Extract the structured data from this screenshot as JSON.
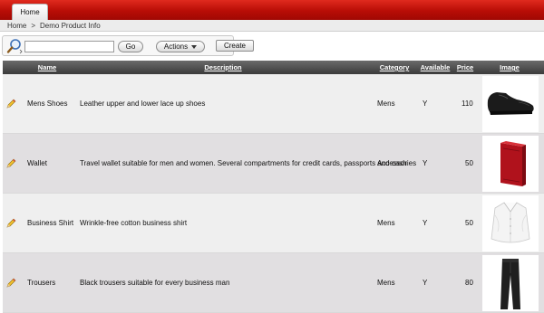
{
  "tabs": [
    {
      "label": "Home"
    }
  ],
  "breadcrumb": {
    "items": [
      "Home",
      "Demo Product Info"
    ],
    "separator": ">"
  },
  "search": {
    "value": "",
    "placeholder": "",
    "go_label": "Go",
    "actions_label": "Actions"
  },
  "toolbar": {
    "create_label": "Create"
  },
  "table": {
    "headers": {
      "name": "Name",
      "description": "Description",
      "category": "Category",
      "available": "Available",
      "price": "Price",
      "image": "Image"
    },
    "rows": [
      {
        "name": "Mens Shoes",
        "description": "Leather upper and lower lace up shoes",
        "category": "Mens",
        "available": "Y",
        "price": "110",
        "image_icon": "shoe-image"
      },
      {
        "name": "Wallet",
        "description": "Travel wallet suitable for men and women. Several compartments for credit cards, passports and cash",
        "category": "Accessories",
        "available": "Y",
        "price": "50",
        "image_icon": "wallet-image"
      },
      {
        "name": "Business Shirt",
        "description": "Wrinkle-free cotton business shirt",
        "category": "Mens",
        "available": "Y",
        "price": "50",
        "image_icon": "shirt-image"
      },
      {
        "name": "Trousers",
        "description": "Black trousers suitable for every business man",
        "category": "Mens",
        "available": "Y",
        "price": "80",
        "image_icon": "trousers-image"
      }
    ]
  },
  "colors": {
    "accent": "#c0140b",
    "header_bg": "#4a4a4a",
    "row_odd": "#efefef",
    "row_even": "#e1dfe1"
  }
}
